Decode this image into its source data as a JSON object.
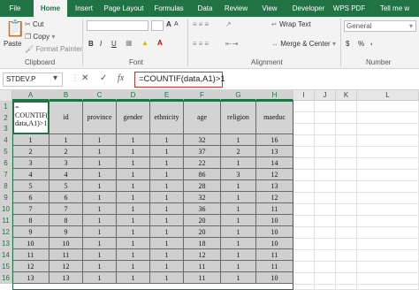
{
  "ribbon_tabs": [
    "File",
    "Home",
    "Insert",
    "Page Layout",
    "Formulas",
    "Data",
    "Review",
    "View",
    "Developer",
    "WPS PDF",
    "Tell me w"
  ],
  "active_tab": "Home",
  "clipboard": {
    "paste": "Paste",
    "cut": "Cut",
    "copy": "Copy",
    "format_painter": "Format Painter",
    "label": "Clipboard"
  },
  "font": {
    "label": "Font",
    "bold": "B",
    "italic": "I",
    "underline": "U",
    "grow": "A",
    "shrink": "A"
  },
  "alignment": {
    "wrap": "Wrap Text",
    "merge": "Merge & Center",
    "label": "Alignment"
  },
  "number": {
    "format": "General",
    "currency": "$",
    "percent": "%",
    "comma": ",",
    "label": "Number"
  },
  "formula_bar": {
    "name_box": "STDEV.P",
    "cancel": "✕",
    "enter": "✓",
    "fx": "fx",
    "formula": "=COUNTIF(data,A1)>1"
  },
  "columns": [
    "A",
    "B",
    "C",
    "D",
    "E",
    "F",
    "G",
    "H",
    "I",
    "J",
    "K",
    "L"
  ],
  "rows": [
    "1",
    "2",
    "3",
    "4",
    "5",
    "6",
    "7",
    "8",
    "9",
    "10",
    "11",
    "12",
    "13",
    "14",
    "15",
    "16"
  ],
  "active_cell_text": "=\nCOUNTIF(\ndata,A1)>1",
  "table": {
    "headers": [
      "id",
      "province",
      "gender",
      "ethnicity",
      "age",
      "religion",
      "maeduc"
    ],
    "rows": [
      [
        "1",
        "1",
        "1",
        "1",
        "1",
        "32",
        "1",
        "16"
      ],
      [
        "2",
        "2",
        "1",
        "1",
        "1",
        "37",
        "2",
        "13"
      ],
      [
        "3",
        "3",
        "1",
        "1",
        "1",
        "22",
        "1",
        "14"
      ],
      [
        "4",
        "4",
        "1",
        "1",
        "1",
        "86",
        "3",
        "12"
      ],
      [
        "5",
        "5",
        "1",
        "1",
        "1",
        "28",
        "1",
        "13"
      ],
      [
        "6",
        "6",
        "1",
        "1",
        "1",
        "32",
        "1",
        "12"
      ],
      [
        "7",
        "7",
        "1",
        "1",
        "1",
        "36",
        "1",
        "11"
      ],
      [
        "8",
        "8",
        "1",
        "1",
        "1",
        "20",
        "1",
        "10"
      ],
      [
        "9",
        "9",
        "1",
        "1",
        "1",
        "20",
        "1",
        "10"
      ],
      [
        "10",
        "10",
        "1",
        "1",
        "1",
        "18",
        "1",
        "10"
      ],
      [
        "11",
        "11",
        "1",
        "1",
        "1",
        "12",
        "1",
        "11"
      ],
      [
        "12",
        "12",
        "1",
        "1",
        "1",
        "11",
        "1",
        "11"
      ],
      [
        "13",
        "13",
        "1",
        "1",
        "1",
        "11",
        "1",
        "10"
      ]
    ]
  },
  "colors": {
    "ribbon_green": "#217346",
    "data_fill": "#cfcfcf",
    "formula_border": "#c0392b"
  }
}
